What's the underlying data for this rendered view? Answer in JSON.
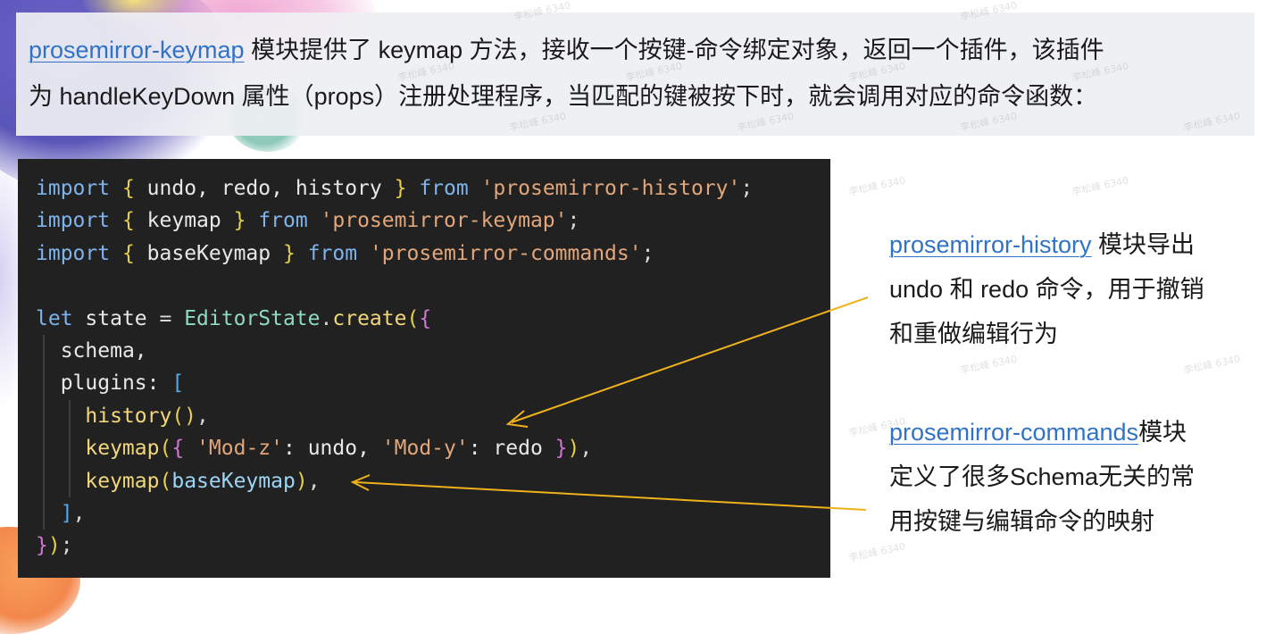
{
  "intro": {
    "link": "prosemirror-keymap",
    "line1_rest": " 模块提供了 keymap 方法，接收一个按键-命令绑定对象，返回一个插件，该插件",
    "line2": "为 handleKeyDown 属性（props）注册处理程序，当匹配的键被按下时，就会调用对应的命令函数："
  },
  "code": {
    "t_import": "import",
    "t_from": "from",
    "t_let": "let",
    "l1_ids": " undo, redo, history ",
    "l1_str": "'prosemirror-history'",
    "l2_ids": " keymap ",
    "l2_str": "'prosemirror-keymap'",
    "l3_ids": " baseKeymap ",
    "l3_str": "'prosemirror-commands'",
    "l5_state": " state ",
    "l5_cls": "EditorState",
    "l5_fn": "create",
    "l6": "schema,",
    "l7": "plugins: ",
    "l8_fn": "history",
    "l9_fn": "keymap",
    "l9_s1": "'Mod-z'",
    "l9_id1": ": undo, ",
    "l9_s2": "'Mod-y'",
    "l9_id2": ": redo ",
    "l10_fn": "keymap",
    "l10_arg": "baseKeymap"
  },
  "annotations": {
    "history_link": "prosemirror-history",
    "history_text1": " 模块导出",
    "history_text2": "undo 和 redo 命令，用于撤销",
    "history_text3": "和重做编辑行为",
    "commands_link": "prosemirror-commands",
    "commands_text1": "模块",
    "commands_text2": "定义了很多Schema无关的常",
    "commands_text3": "用按键与编辑命令的映射"
  },
  "watermark": "李松峰 6340",
  "colors": {
    "link": "#2f73c9",
    "arrow": "#f0b21a",
    "code_bg": "#212121",
    "intro_bg": "#eeeff3"
  }
}
